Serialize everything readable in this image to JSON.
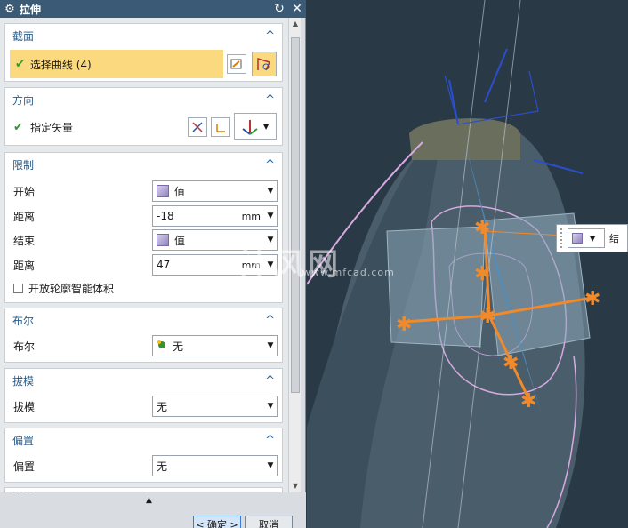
{
  "dialog": {
    "title": "拉伸",
    "gear_icon": "⚙",
    "reset_icon": "↻",
    "close_icon": "✕"
  },
  "section_section": {
    "header": "截面",
    "select_curve": "选择曲线 (4)"
  },
  "direction": {
    "header": "方向",
    "specify_vector": "指定矢量"
  },
  "limits": {
    "header": "限制",
    "start_label": "开始",
    "start_value": "值",
    "start_dist_label": "距离",
    "start_dist_value": "-18",
    "start_dist_unit": "mm",
    "end_label": "结束",
    "end_value": "值",
    "end_dist_label": "距离",
    "end_dist_value": "47",
    "end_dist_unit": "mm",
    "open_profile": "开放轮廓智能体积"
  },
  "boolean": {
    "header": "布尔",
    "label": "布尔",
    "value": "无"
  },
  "draft": {
    "header": "拔模",
    "label": "拔模",
    "value": "无"
  },
  "offset": {
    "header": "偏置",
    "label": "偏置",
    "value": "无"
  },
  "settings": {
    "header": "设置"
  },
  "footer": {
    "ok": "< 确定 >",
    "cancel": "取消"
  },
  "viewport_popup": {
    "text": "结"
  },
  "watermark": {
    "text": "沐风网",
    "sub": "www.mfcad.com"
  },
  "colors": {
    "titlebar": "#3b5a75",
    "highlight": "#fbd97f",
    "section_header": "#2b5c8a",
    "viewport_bg": "#2a3946",
    "arrow_orange": "#f08a2a"
  }
}
